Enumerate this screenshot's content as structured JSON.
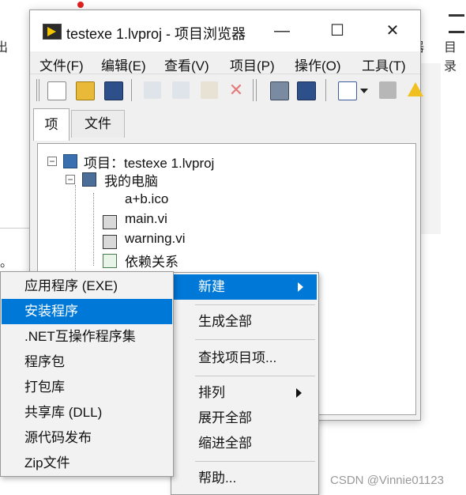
{
  "window": {
    "title": "testexe 1.lvproj - 项目浏览器",
    "controls": {
      "minimize": "—",
      "maximize": "☐",
      "close": "✕"
    }
  },
  "menubar": [
    "文件(F)",
    "编辑(E)",
    "查看(V)",
    "项目(P)",
    "操作(O)",
    "工具(T)"
  ],
  "tabs": [
    "项",
    "文件"
  ],
  "tree": {
    "root": "项目：testexe 1.lvproj",
    "computer": "我的电脑",
    "files": [
      "a+b.ico",
      "main.vi",
      "warning.vi"
    ],
    "dependencies": "依赖关系"
  },
  "context_menu": {
    "items": [
      "新建",
      "生成全部",
      "查找项目项...",
      "排列",
      "展开全部",
      "缩进全部",
      "帮助..."
    ]
  },
  "submenu": {
    "items": [
      "应用程序 (EXE)",
      "安装程序",
      ".NET互操作程序集",
      "程序包",
      "打包库",
      "共享库 (DLL)",
      "源代码发布",
      "Zip文件"
    ]
  },
  "background": {
    "right_top_1": "器",
    "right_top_2": "目录",
    "left_1": "出",
    "left_2": "。",
    "watermark": "CSDN @Vinnie01123"
  },
  "colors": {
    "highlight": "#0078d7"
  }
}
